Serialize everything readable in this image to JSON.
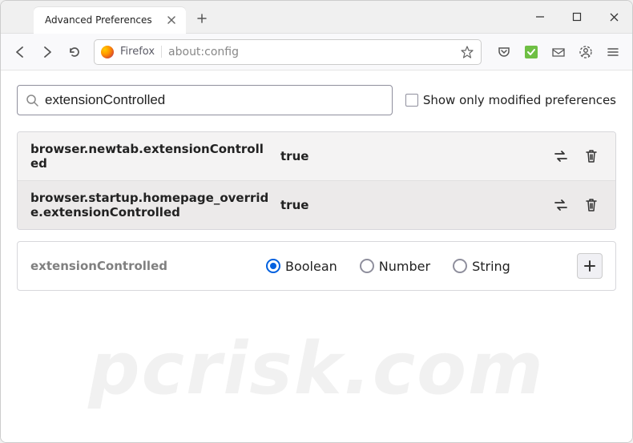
{
  "tab": {
    "title": "Advanced Preferences"
  },
  "address": {
    "identity": "Firefox",
    "url": "about:config"
  },
  "search": {
    "value": "extensionControlled",
    "checkbox_label": "Show only modified preferences",
    "checked": false
  },
  "prefs": [
    {
      "name": "browser.newtab.extensionControlled",
      "value": "true"
    },
    {
      "name": "browser.startup.homepage_override.extensionControlled",
      "value": "true"
    }
  ],
  "new_pref": {
    "name": "extensionControlled",
    "types": [
      "Boolean",
      "Number",
      "String"
    ],
    "selected": "Boolean"
  },
  "watermark": "pcrisk.com"
}
